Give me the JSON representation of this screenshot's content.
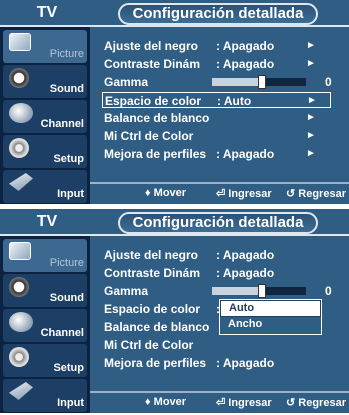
{
  "header": {
    "tv": "TV",
    "title": "Configuración detallada"
  },
  "sidebar": [
    {
      "label": "Picture",
      "icon": "picture-icon"
    },
    {
      "label": "Sound",
      "icon": "sound-icon"
    },
    {
      "label": "Channel",
      "icon": "channel-icon"
    },
    {
      "label": "Setup",
      "icon": "setup-icon"
    },
    {
      "label": "Input",
      "icon": "input-icon"
    }
  ],
  "menu_a": {
    "rows": [
      {
        "label": "Ajuste del negro",
        "value": ": Apagado",
        "arrow": "►"
      },
      {
        "label": "Contraste Dinám",
        "value": ": Apagado",
        "arrow": "►"
      },
      {
        "label": "Gamma",
        "slider_level": 0.5,
        "value": "0"
      },
      {
        "label": "Espacio de color",
        "value": ": Auto",
        "arrow": "►"
      },
      {
        "label": "Balance de blanco",
        "arrow": "►"
      },
      {
        "label": "Mi Ctrl de Color",
        "arrow": "►"
      },
      {
        "label": "Mejora de perfiles",
        "value": ": Apagado",
        "arrow": "►"
      }
    ]
  },
  "menu_b": {
    "rows": [
      {
        "label": "Ajuste del negro",
        "value": ": Apagado"
      },
      {
        "label": "Contraste Dinám",
        "value": ": Apagado"
      },
      {
        "label": "Gamma",
        "slider_level": 0.5,
        "value": "0"
      },
      {
        "label": "Espacio de color",
        "value": ":"
      },
      {
        "label": "Balance de blanco"
      },
      {
        "label": "Mi Ctrl de Color"
      },
      {
        "label": "Mejora de perfiles",
        "value": ": Apagado"
      }
    ],
    "dropdown": {
      "options": [
        "Auto",
        "Ancho"
      ],
      "selected": "Auto"
    }
  },
  "footer": {
    "move": "♦ Mover",
    "enter": "⏎ Ingresar",
    "return": "↺ Regresar"
  },
  "colors": {
    "background": "#2f5d84",
    "sidebar": "#0b2340",
    "text": "#ffffff"
  }
}
